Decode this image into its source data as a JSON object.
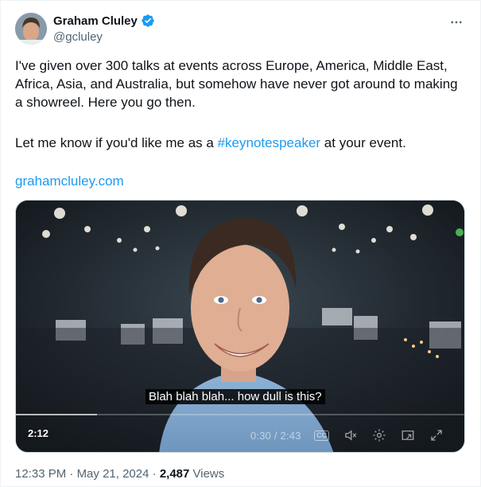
{
  "author": {
    "name": "Graham Cluley",
    "handle": "@gcluley",
    "verified_color": "#1d9bf0"
  },
  "tweet": {
    "text_line1": "I've given over 300 talks at events across  Europe, America, Middle East, Africa, Asia, and Australia, but somehow have never got around to making a showreel.  Here you go then.",
    "text_line2_before": "Let me know if you'd like me as a ",
    "hashtag": "#keynotespeaker",
    "text_line2_after": " at your event.",
    "link": "grahamcluley.com"
  },
  "video": {
    "caption": "Blah blah blah... how dull is this?",
    "elapsed_badge": "2:12",
    "time_readout": "0:30 / 2:43",
    "cc_label": "CC",
    "progress": 0.18
  },
  "meta": {
    "time": "12:33 PM",
    "date": "May 21, 2024",
    "separator": " · ",
    "views_count": "2,487",
    "views_label": " Views"
  },
  "icons": {
    "more": "more-horizontal-icon",
    "verified": "verified-badge-icon",
    "volume": "volume-muted-icon",
    "settings": "gear-icon",
    "pip": "picture-in-picture-icon",
    "fullscreen": "fullscreen-icon"
  }
}
